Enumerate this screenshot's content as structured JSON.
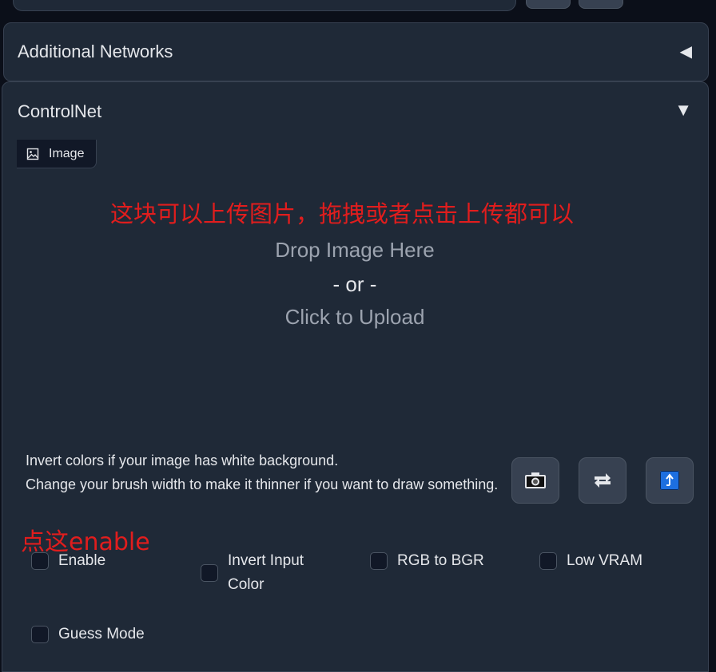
{
  "accordions": {
    "additional_networks": {
      "title": "Additional Networks",
      "toggle": "◀"
    },
    "controlnet": {
      "title": "ControlNet",
      "toggle": "▼"
    }
  },
  "tab": {
    "label": "Image",
    "icon": "image-icon"
  },
  "annotations": {
    "upload_note": "这块可以上传图片，拖拽或者点击上传都可以",
    "enable_note": "点这enable"
  },
  "dropzone": {
    "line1": "Drop Image Here",
    "line2": "- or -",
    "line3": "Click to Upload"
  },
  "hints": {
    "line1": "Invert colors if your image has white background.",
    "line2": "Change your brush width to make it thinner if you want to draw something."
  },
  "tools": [
    {
      "name": "camera-icon"
    },
    {
      "name": "swap-icon"
    },
    {
      "name": "send-dimensions-icon"
    }
  ],
  "checkboxes": {
    "enable": "Enable",
    "invert_line1": "Invert Input",
    "invert_line2": "Color",
    "rgb_to_bgr": "RGB to BGR",
    "low_vram": "Low VRAM",
    "guess_mode": "Guess Mode"
  },
  "colors": {
    "panel_bg": "#1f2937",
    "annotation_red": "#e11d1d",
    "accent_blue": "#1d6fe0"
  }
}
